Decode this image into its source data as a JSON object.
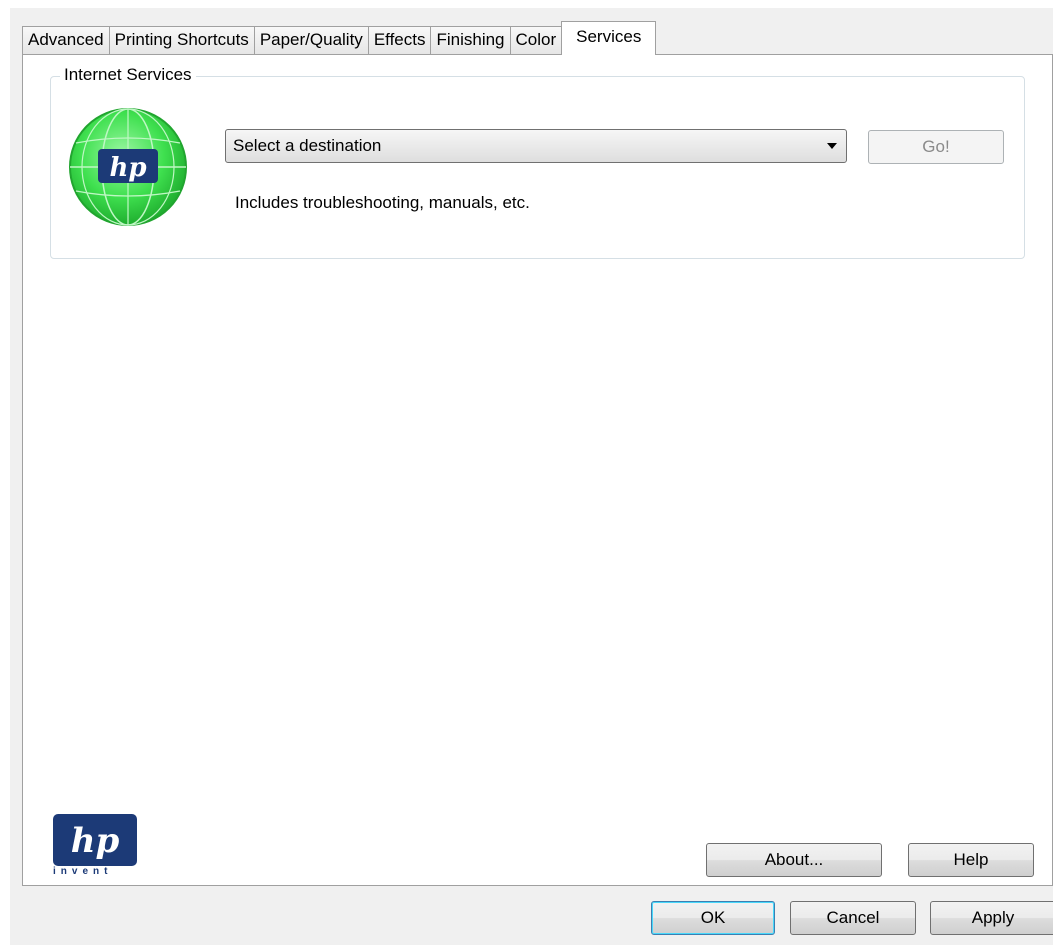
{
  "tabs": [
    {
      "label": "Advanced",
      "active": false
    },
    {
      "label": "Printing Shortcuts",
      "active": false
    },
    {
      "label": "Paper/Quality",
      "active": false
    },
    {
      "label": "Effects",
      "active": false
    },
    {
      "label": "Finishing",
      "active": false
    },
    {
      "label": "Color",
      "active": false
    },
    {
      "label": "Services",
      "active": true
    }
  ],
  "internet_services": {
    "group_label": "Internet Services",
    "destination_select_value": "Select a destination",
    "go_label": "Go!",
    "hint": "Includes troubleshooting, manuals, etc.",
    "icon": "hp-globe-icon"
  },
  "branding": {
    "logo_text": "hp",
    "tagline": "invent",
    "brand_color": "#1c3a77",
    "globe_color": "#3fe04f"
  },
  "page_buttons": {
    "about_label": "About...",
    "help_label": "Help"
  },
  "dialog_buttons": {
    "ok_label": "OK",
    "cancel_label": "Cancel",
    "apply_label": "Apply"
  }
}
